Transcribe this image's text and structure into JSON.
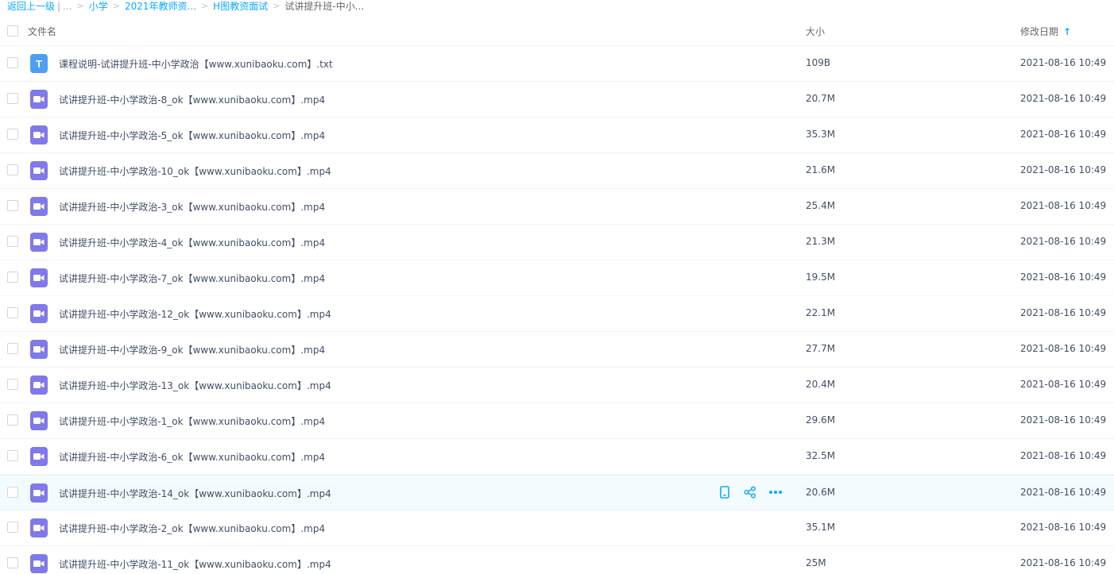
{
  "breadcrumb": {
    "back": "返回上一级",
    "sep": "|",
    "ellipsis": "...",
    "items": [
      "小学",
      "2021年教师资...",
      "H图教资面试"
    ],
    "current": "试讲提升班-中小..."
  },
  "header": {
    "name": "文件名",
    "size": "大小",
    "date": "修改日期",
    "sort_arrow": "↑"
  },
  "accent_color": "#09aaff",
  "icons": {
    "txt": "text-file-icon",
    "video": "video-file-icon",
    "actions": [
      "phone-icon",
      "share-icon",
      "more-icon"
    ]
  },
  "files": [
    {
      "name": "课程说明-试讲提升班-中小学政治【www.xunibaoku.com】.txt",
      "size": "109B",
      "date": "2021-08-16 10:49",
      "type": "txt",
      "icon_glyph": "T"
    },
    {
      "name": "试讲提升班-中小学政治-8_ok【www.xunibaoku.com】.mp4",
      "size": "20.7M",
      "date": "2021-08-16 10:49",
      "type": "video"
    },
    {
      "name": "试讲提升班-中小学政治-5_ok【www.xunibaoku.com】.mp4",
      "size": "35.3M",
      "date": "2021-08-16 10:49",
      "type": "video"
    },
    {
      "name": "试讲提升班-中小学政治-10_ok【www.xunibaoku.com】.mp4",
      "size": "21.6M",
      "date": "2021-08-16 10:49",
      "type": "video"
    },
    {
      "name": "试讲提升班-中小学政治-3_ok【www.xunibaoku.com】.mp4",
      "size": "25.4M",
      "date": "2021-08-16 10:49",
      "type": "video"
    },
    {
      "name": "试讲提升班-中小学政治-4_ok【www.xunibaoku.com】.mp4",
      "size": "21.3M",
      "date": "2021-08-16 10:49",
      "type": "video"
    },
    {
      "name": "试讲提升班-中小学政治-7_ok【www.xunibaoku.com】.mp4",
      "size": "19.5M",
      "date": "2021-08-16 10:49",
      "type": "video"
    },
    {
      "name": "试讲提升班-中小学政治-12_ok【www.xunibaoku.com】.mp4",
      "size": "22.1M",
      "date": "2021-08-16 10:49",
      "type": "video"
    },
    {
      "name": "试讲提升班-中小学政治-9_ok【www.xunibaoku.com】.mp4",
      "size": "27.7M",
      "date": "2021-08-16 10:49",
      "type": "video"
    },
    {
      "name": "试讲提升班-中小学政治-13_ok【www.xunibaoku.com】.mp4",
      "size": "20.4M",
      "date": "2021-08-16 10:49",
      "type": "video"
    },
    {
      "name": "试讲提升班-中小学政治-1_ok【www.xunibaoku.com】.mp4",
      "size": "29.6M",
      "date": "2021-08-16 10:49",
      "type": "video"
    },
    {
      "name": "试讲提升班-中小学政治-6_ok【www.xunibaoku.com】.mp4",
      "size": "32.5M",
      "date": "2021-08-16 10:49",
      "type": "video"
    },
    {
      "name": "试讲提升班-中小学政治-14_ok【www.xunibaoku.com】.mp4",
      "size": "20.6M",
      "date": "2021-08-16 10:49",
      "type": "video",
      "hover": true
    },
    {
      "name": "试讲提升班-中小学政治-2_ok【www.xunibaoku.com】.mp4",
      "size": "35.1M",
      "date": "2021-08-16 10:49",
      "type": "video"
    },
    {
      "name": "试讲提升班-中小学政治-11_ok【www.xunibaoku.com】.mp4",
      "size": "25M",
      "date": "2021-08-16 10:49",
      "type": "video"
    }
  ]
}
